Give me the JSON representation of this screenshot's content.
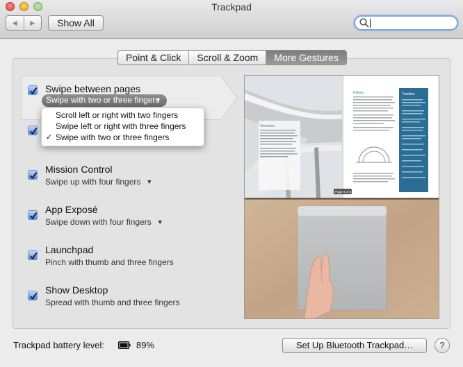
{
  "window": {
    "title": "Trackpad"
  },
  "toolbar": {
    "back_icon": "chevron-left-icon",
    "forward_icon": "chevron-right-icon",
    "show_all_label": "Show All",
    "search_value": "",
    "search_icon": "magnifier-icon"
  },
  "tabs": [
    {
      "label": "Point & Click",
      "active": false
    },
    {
      "label": "Scroll & Zoom",
      "active": false
    },
    {
      "label": "More Gestures",
      "active": true
    }
  ],
  "gestures": [
    {
      "title": "Swipe between pages",
      "subtitle": "Swipe with two or three fingers",
      "checked": true,
      "has_menu": true
    },
    {
      "title": "",
      "subtitle": "",
      "checked": true,
      "has_menu": false
    },
    {
      "title": "Mission Control",
      "subtitle": "Swipe up with four fingers",
      "checked": true,
      "has_menu": true
    },
    {
      "title": "App Exposé",
      "subtitle": "Swipe down with four fingers",
      "checked": true,
      "has_menu": true
    },
    {
      "title": "Launchpad",
      "subtitle": "Pinch with thumb and three fingers",
      "checked": true,
      "has_menu": false
    },
    {
      "title": "Show Desktop",
      "subtitle": "Spread with thumb and three fingers",
      "checked": true,
      "has_menu": false
    }
  ],
  "dropdown_menu": {
    "items": [
      {
        "label": "Scroll left or right with two fingers",
        "checked": false
      },
      {
        "label": "Swipe left or right with three fingers",
        "checked": false
      },
      {
        "label": "Swipe with two or three fingers",
        "checked": true
      }
    ]
  },
  "preview": {
    "book_left_heading": "Overview",
    "book_right_heading": "History",
    "book_sidebar_heading": "Timeline",
    "page_indicator": "Page 4 of 8"
  },
  "footer": {
    "battery_label": "Trackpad battery level:",
    "battery_icon": "battery-icon",
    "battery_value": "89%",
    "setup_button_label": "Set Up Bluetooth Trackpad…",
    "help_label": "?"
  },
  "colors": {
    "accent": "#4b86de",
    "tab_active": "#8a8a8a",
    "popup": "#767676"
  }
}
